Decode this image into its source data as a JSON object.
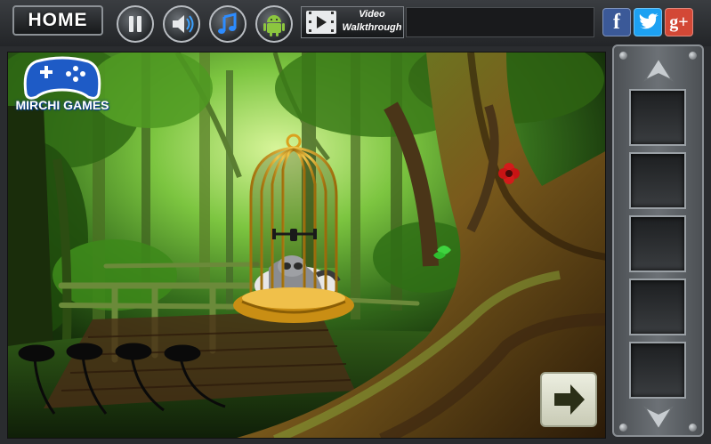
{
  "toolbar": {
    "home_label": "HOME",
    "video_label_line1": "Video",
    "video_label_line2": "Walkthrough"
  },
  "social": {
    "facebook": "f",
    "twitter": "t",
    "googleplus": "g+"
  },
  "logo": {
    "brand": "MIRCHI GAMES"
  },
  "colors": {
    "forest_dark": "#1d3a0e",
    "forest_light": "#8fd14a",
    "cage_gold": "#d9a21e",
    "facebook": "#3b5998",
    "twitter": "#1da1f2",
    "googleplus": "#d34836",
    "logo_blue": "#1e5bc6"
  },
  "icons": [
    "pause-icon",
    "sound-icon",
    "music-icon",
    "android-icon",
    "video-play-icon",
    "next-arrow-icon",
    "up-arrow-icon",
    "down-arrow-icon",
    "gamepad-icon"
  ]
}
